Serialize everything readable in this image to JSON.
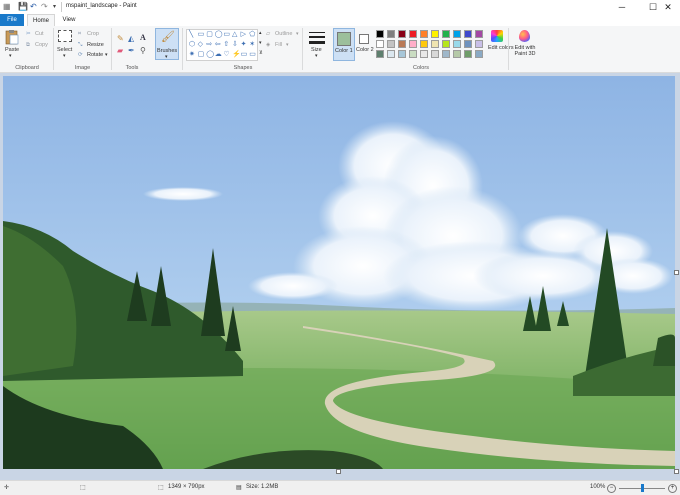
{
  "window": {
    "title": "mspaint_landscape - Paint",
    "minimize_glyph": "─",
    "maximize_glyph": "☐",
    "close_glyph": "✕",
    "quick_access_glyphs": [
      "💾",
      "↶",
      "↷",
      "▾"
    ]
  },
  "tabs": [
    {
      "label": "File"
    },
    {
      "label": "Home"
    },
    {
      "label": "View"
    }
  ],
  "clipboard": {
    "group_label": "Clipboard",
    "paste_label": "Paste",
    "cut_label": "Cut",
    "copy_label": "Copy"
  },
  "image": {
    "group_label": "Image",
    "select_label": "Select",
    "crop_label": "Crop",
    "resize_label": "Resize",
    "rotate_label": "Rotate"
  },
  "tools": {
    "group_label": "Tools",
    "brushes_label": "Brushes",
    "text_glyph": "A"
  },
  "shapes": {
    "group_label": "Shapes",
    "outline_label": "Outline",
    "fill_label": "Fill",
    "glyphs": [
      "╲",
      "▭",
      "▢",
      "◯",
      "▭",
      "△",
      "▷",
      "⬠",
      "⬡",
      "◇",
      "⇨",
      "⇦",
      "⇧",
      "⇩",
      "✦",
      "✶",
      "✷",
      "▢",
      "◯",
      "☁",
      "♡",
      "⚡",
      "▭",
      "▭"
    ]
  },
  "size": {
    "label": "Size"
  },
  "color1": {
    "label": "Color 1",
    "value": "#9cbf9c"
  },
  "color2": {
    "label": "Color 2",
    "value": "#ffffff"
  },
  "colors": {
    "group_label": "Colors",
    "palette": [
      "#000000",
      "#7f7f7f",
      "#880015",
      "#ed1c24",
      "#ff7f27",
      "#fff200",
      "#22b14c",
      "#00a2e8",
      "#3f48cc",
      "#a349a4",
      "#ffffff",
      "#c3c3c3",
      "#b97a57",
      "#ffaec9",
      "#ffc90e",
      "#efe4b0",
      "#b5e61d",
      "#99d9ea",
      "#7092be",
      "#c8bfe7",
      "#5e7f6e",
      "#dbe7ef",
      "#a7c6d8",
      "#c9dcc2",
      "#e8e8e8",
      "#d8d8d8",
      "#9fb7c9",
      "#b5c9a8",
      "#6f9d6a",
      "#8aa9c4"
    ],
    "edit_colors_label": "Edit colors",
    "edit_paint3d_label": "Edit with Paint 3D"
  },
  "status": {
    "dimensions": "1349 × 790px",
    "size": "Size: 1.2MB",
    "zoom": "100%",
    "zoom_fraction": 0.5,
    "zoom_minus": "−",
    "zoom_plus": "+"
  }
}
